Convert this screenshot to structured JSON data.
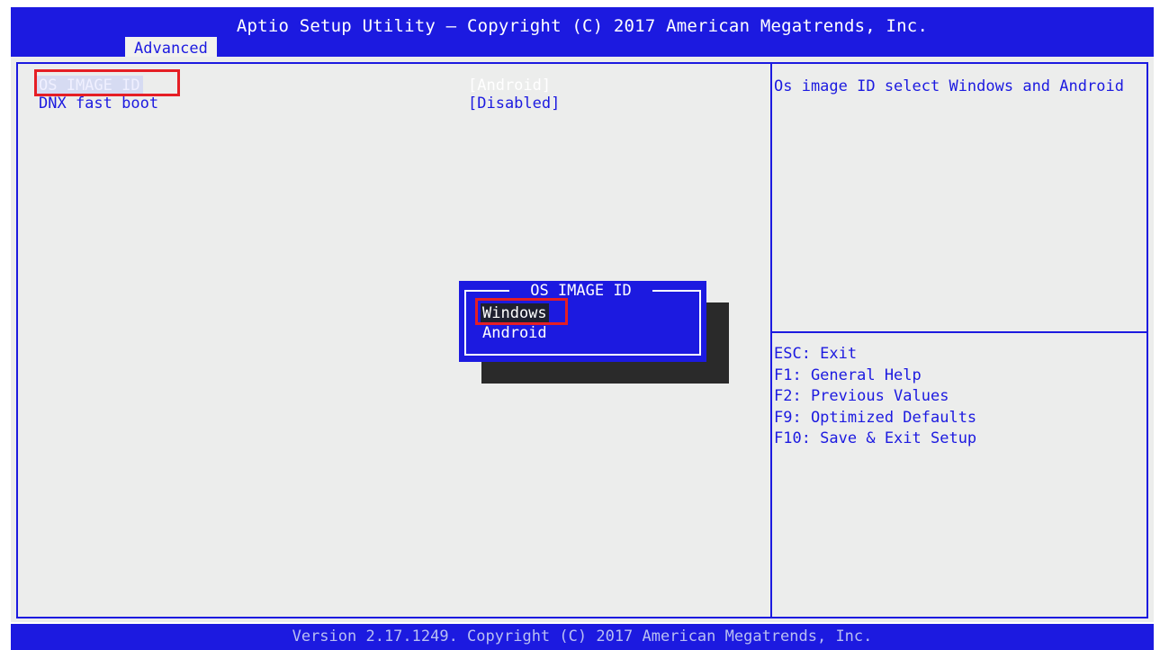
{
  "header": {
    "title": "Aptio Setup Utility – Copyright (C) 2017 American Megatrends, Inc.",
    "tab": "Advanced"
  },
  "settings": [
    {
      "label": "OS IMAGE ID",
      "value": "[Android]"
    },
    {
      "label": "DNX fast boot",
      "value": "[Disabled]"
    }
  ],
  "help": {
    "description": "Os image ID select Windows and Android"
  },
  "keys": [
    "ESC: Exit",
    "F1: General Help",
    "F2: Previous Values",
    "F9: Optimized Defaults",
    "F10: Save & Exit Setup"
  ],
  "popup": {
    "title": "OS IMAGE ID",
    "options": [
      "Windows",
      "Android"
    ],
    "selected": "Windows"
  },
  "footer": {
    "version": "Version 2.17.1249. Copyright (C) 2017 American Megatrends, Inc."
  },
  "colors": {
    "bios_blue": "#1c1ae0",
    "background": "#ecedec",
    "highlight_red": "#e51e25"
  }
}
